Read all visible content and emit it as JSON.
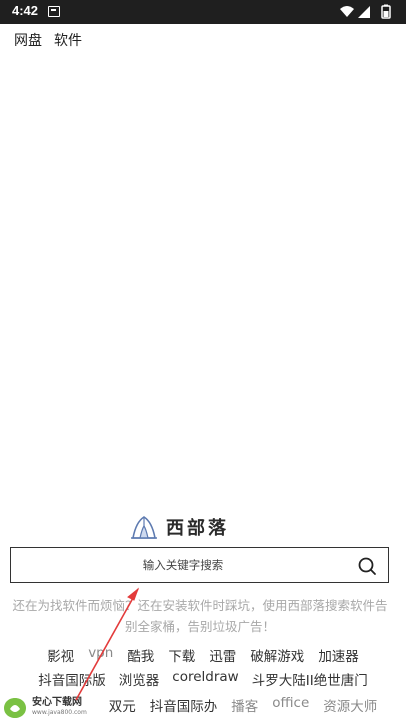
{
  "status_bar": {
    "time": "4:42"
  },
  "top_tabs": [
    {
      "label": "网盘"
    },
    {
      "label": "软件"
    }
  ],
  "logo": {
    "title": "西部落"
  },
  "search": {
    "placeholder": "输入关键字搜索"
  },
  "slogan": "还在为找软件而烦恼？还在安装软件时踩坑，使用西部落搜索软件告别全家桶，告别垃圾广告！",
  "keywords": {
    "row1": [
      "影视",
      "vpn",
      "酷我",
      "下载",
      "迅雷",
      "破解游戏",
      "加速器"
    ],
    "row2": [
      "抖音国际版",
      "浏览器",
      "coreldraw",
      "斗罗大陆II绝世唐门"
    ],
    "row3": [
      "双元",
      "抖音国际办",
      "播客",
      "office",
      "资源大师"
    ]
  },
  "watermark": {
    "name": "安心下载网",
    "url": "www.java800.com"
  },
  "colors": {
    "annotation_arrow": "#e33b3b",
    "search_border": "#333333",
    "slogan": "#a8a8a8"
  }
}
